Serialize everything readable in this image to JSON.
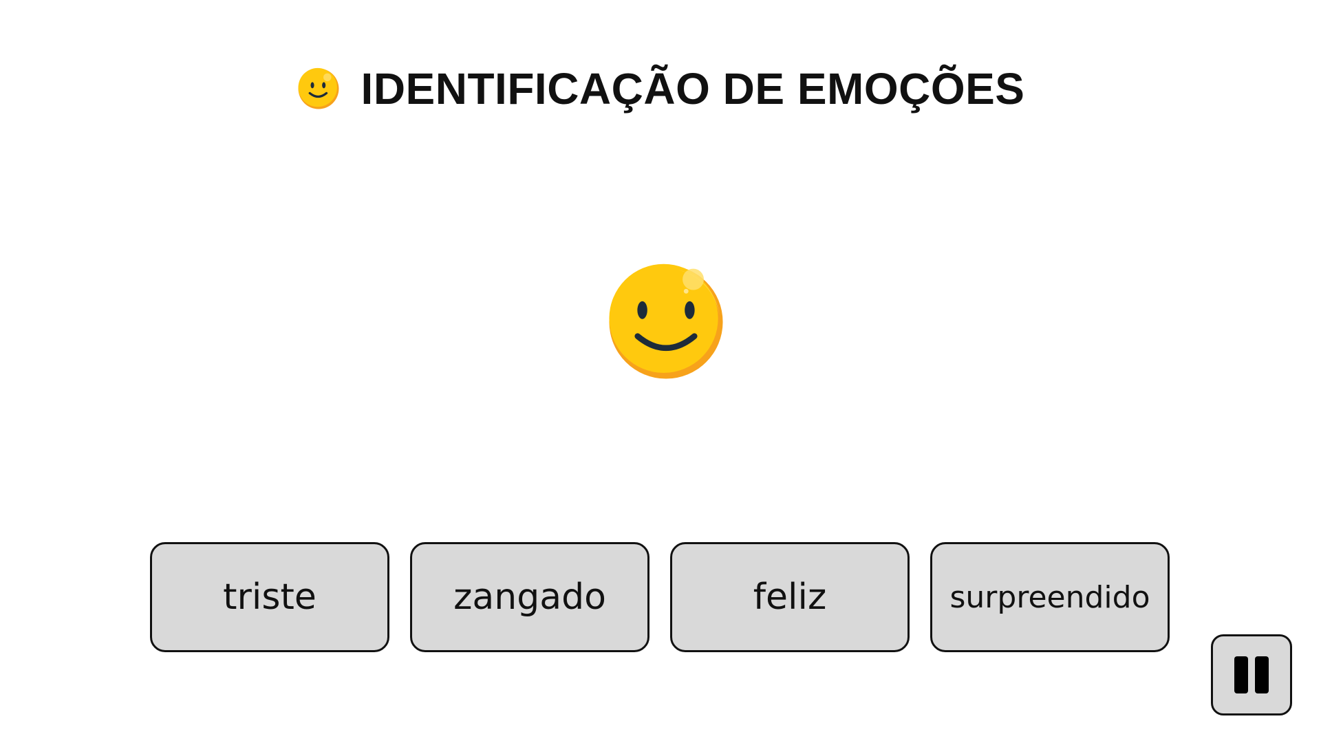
{
  "header": {
    "icon": "smiley-face-icon",
    "title": "IDENTIFICAÇÃO DE EMOÇÕES"
  },
  "stimulus": {
    "icon": "smiley-face-icon"
  },
  "options": [
    {
      "label": "triste"
    },
    {
      "label": "zangado"
    },
    {
      "label": "feliz"
    },
    {
      "label": "surpreendido"
    }
  ],
  "controls": {
    "pause_icon": "pause-icon"
  },
  "colors": {
    "emoji_face": "#FFC90E",
    "emoji_shade": "#F7A21B",
    "emoji_features": "#1D2B3A",
    "button_bg": "#D9D9D9",
    "button_border": "#111111"
  }
}
